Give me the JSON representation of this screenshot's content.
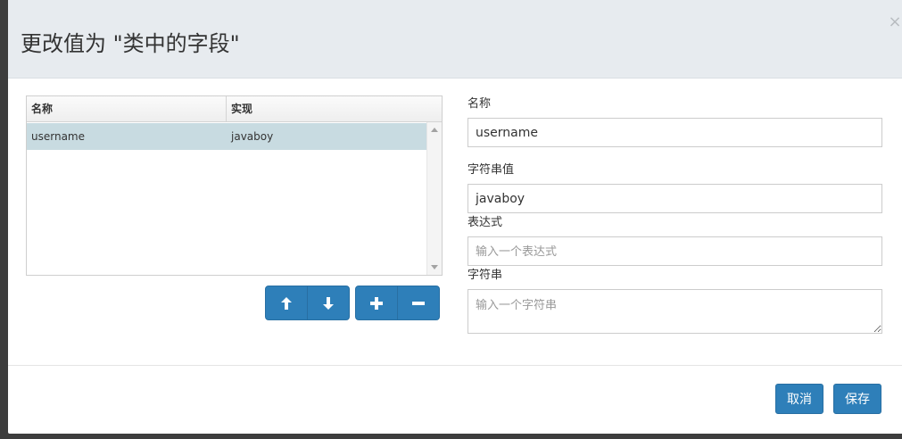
{
  "dialog": {
    "title": "更改值为 \"类中的字段\"",
    "close_label": "×"
  },
  "grid": {
    "columns": [
      "名称",
      "实现"
    ],
    "rows": [
      {
        "name": "username",
        "impl": "javaboy",
        "selected": true
      }
    ]
  },
  "toolbar": {
    "move_up_icon": "arrow-up-icon",
    "move_down_icon": "arrow-down-icon",
    "add_icon": "plus-icon",
    "remove_icon": "minus-icon"
  },
  "form": {
    "name_label": "名称",
    "name_value": "username",
    "string_value_label": "字符串值",
    "string_value": "javaboy",
    "expression_label": "表达式",
    "expression_placeholder": "输入一个表达式",
    "string_label": "字符串",
    "string_placeholder": "输入一个字符串"
  },
  "footer": {
    "cancel_label": "取消",
    "save_label": "保存"
  },
  "colors": {
    "primary": "#2e7fb9",
    "header_bg": "#e7ebef",
    "selected_row": "#c8dbe1"
  }
}
